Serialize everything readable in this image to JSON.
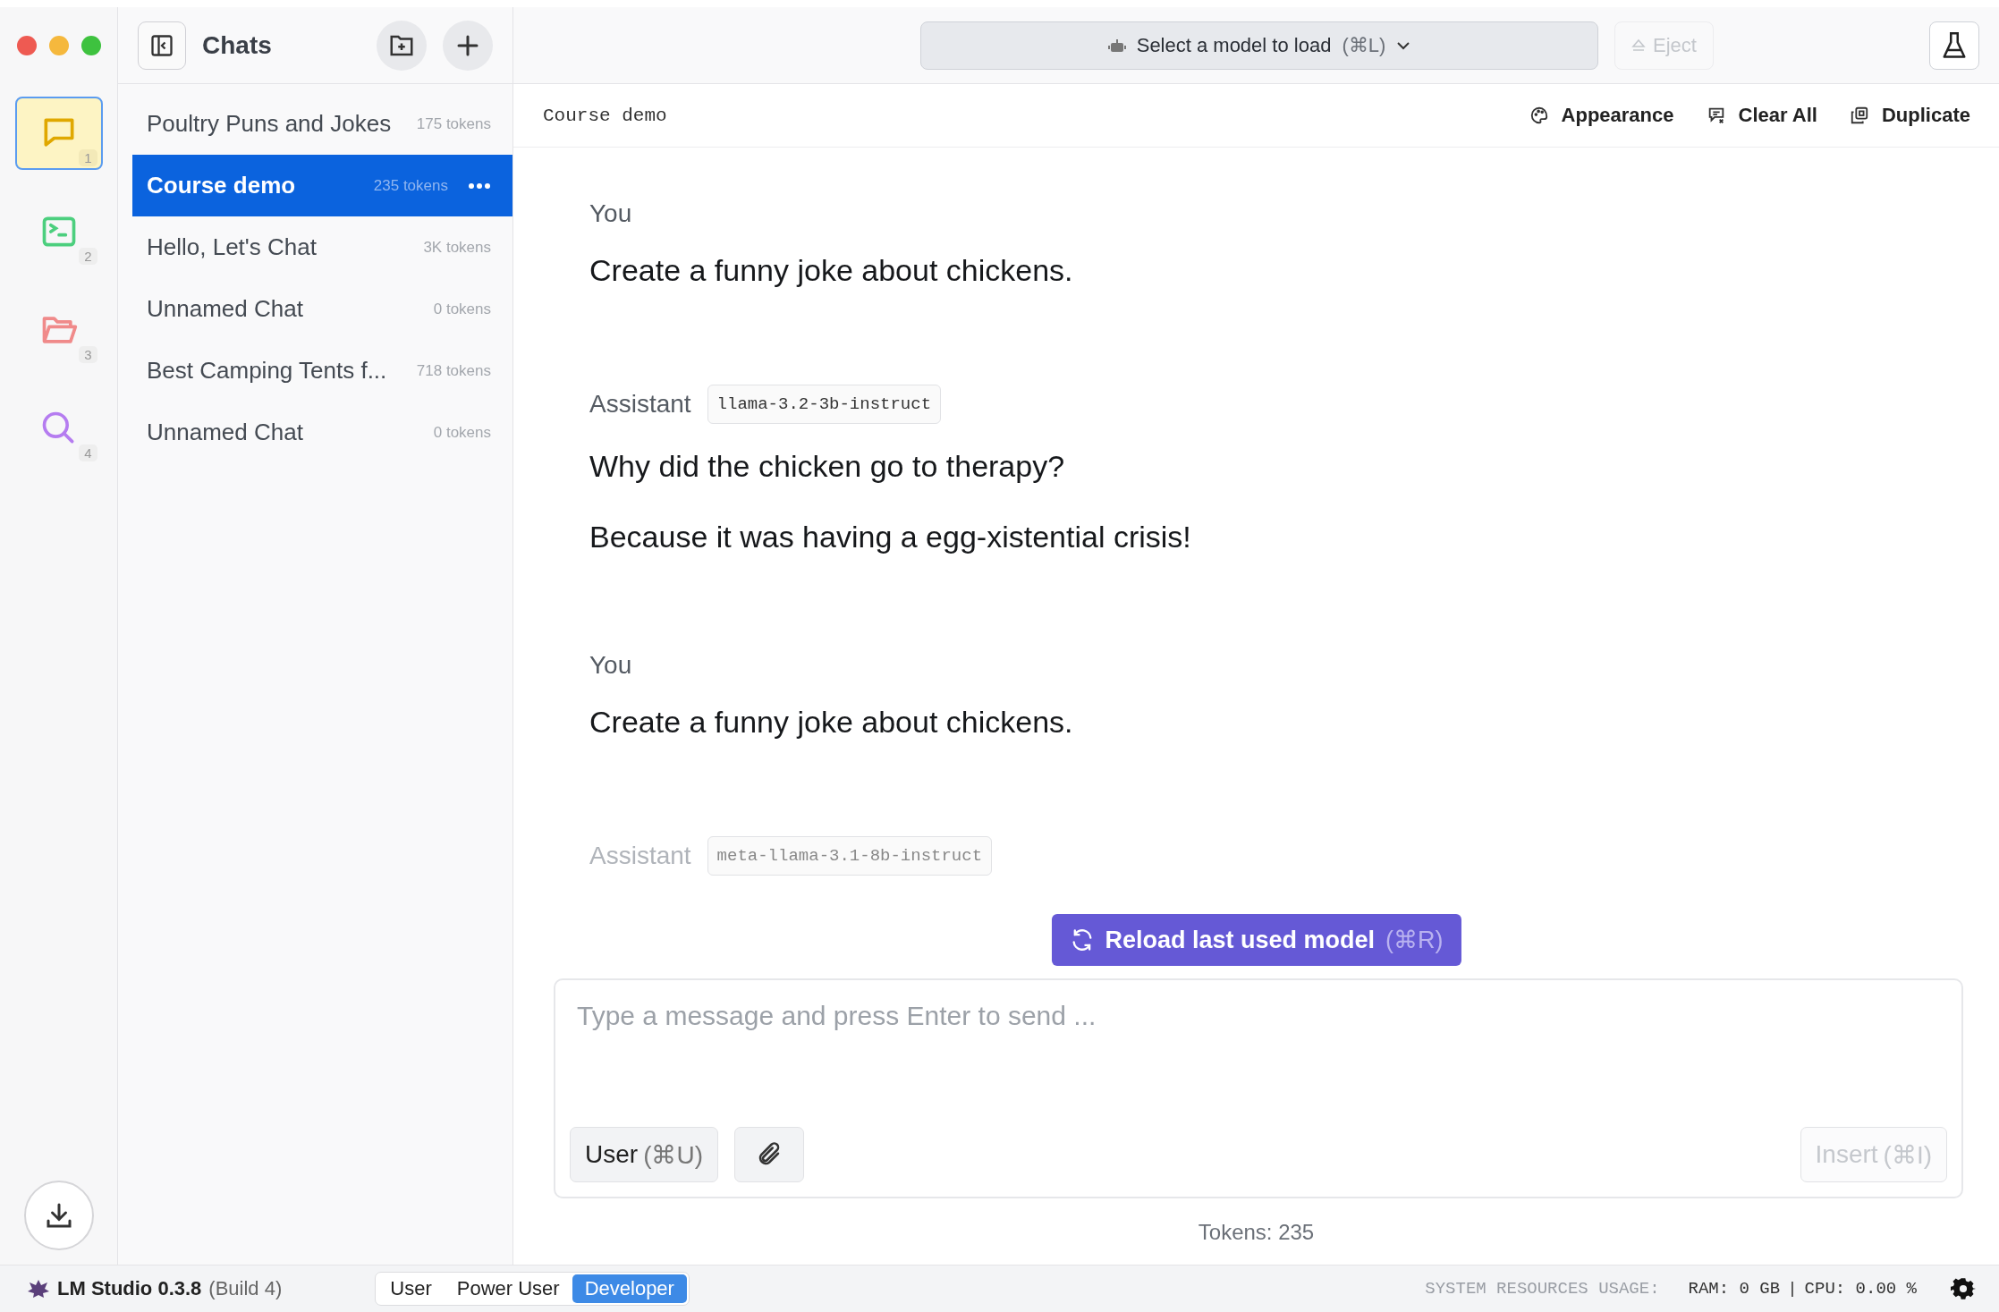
{
  "rail": [
    {
      "kind": "chat",
      "badge": "1",
      "selected": true
    },
    {
      "kind": "terminal",
      "badge": "2",
      "selected": false
    },
    {
      "kind": "folder",
      "badge": "3",
      "selected": false
    },
    {
      "kind": "search",
      "badge": "4",
      "selected": false
    }
  ],
  "sidebar": {
    "title": "Chats",
    "items": [
      {
        "title": "Poultry Puns and Jokes",
        "tokens": "175 tokens",
        "selected": false
      },
      {
        "title": "Course demo",
        "tokens": "235 tokens",
        "selected": true
      },
      {
        "title": "Hello, Let's Chat",
        "tokens": "3K tokens",
        "selected": false
      },
      {
        "title": "Unnamed Chat",
        "tokens": "0 tokens",
        "selected": false
      },
      {
        "title": "Best Camping Tents f...",
        "tokens": "718 tokens",
        "selected": false
      },
      {
        "title": "Unnamed Chat",
        "tokens": "0 tokens",
        "selected": false
      }
    ]
  },
  "topbar": {
    "model_select": "Select a model to load",
    "shortcut": "(⌘L)",
    "eject": "Eject",
    "eject_disabled": true
  },
  "chat_header": {
    "title": "Course demo",
    "actions": [
      {
        "kind": "palette",
        "label": "Appearance"
      },
      {
        "kind": "clear",
        "label": "Clear All"
      },
      {
        "kind": "duplicate",
        "label": "Duplicate"
      }
    ]
  },
  "messages": [
    {
      "role": "You",
      "faded": false,
      "paragraphs": [
        "Create a funny joke about chickens."
      ]
    },
    {
      "role": "Assistant",
      "model": "llama-3.2-3b-instruct",
      "faded": false,
      "paragraphs": [
        "Why did the chicken go to therapy?",
        "Because it was having a egg-xistential crisis!"
      ]
    },
    {
      "role": "You",
      "faded": false,
      "paragraphs": [
        "Create a funny joke about chickens."
      ]
    },
    {
      "role": "Assistant",
      "model": "meta-llama-3.1-8b-instruct",
      "faded": true
    }
  ],
  "reload_button": {
    "label": "Reload last used model",
    "shortcut": "(⌘R)"
  },
  "composer": {
    "placeholder": "Type a message and press Enter to send ...",
    "role_button": "User",
    "role_shortcut": "(⌘U)",
    "insert": "Insert",
    "insert_shortcut": "(⌘I)",
    "insert_disabled": true
  },
  "token_count": "Tokens: 235",
  "status_bar": {
    "app": "LM Studio 0.3.8",
    "build": "(Build 4)",
    "modes": [
      {
        "label": "User",
        "selected": false
      },
      {
        "label": "Power User",
        "selected": false
      },
      {
        "label": "Developer",
        "selected": true
      }
    ],
    "resources_label": "SYSTEM RESOURCES USAGE:",
    "ram": "RAM: 0 GB",
    "separator": "|",
    "cpu": "CPU: 0.00 %"
  }
}
